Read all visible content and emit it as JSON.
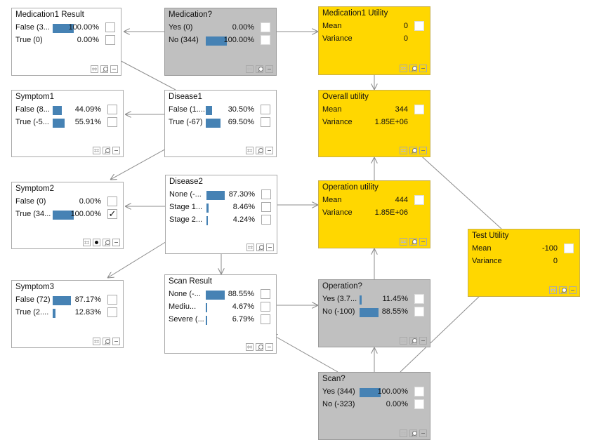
{
  "colors": {
    "bar": "#4682b4",
    "decision_bg": "#c0c0c0",
    "utility_bg": "#ffd700",
    "chance_bg": "#ffffff",
    "edge": "#8c8c8c"
  },
  "nodes": {
    "medication1_result": {
      "title": "Medication1 Result",
      "type": "chance",
      "states": [
        {
          "label": "False (3...",
          "prob": 1.0,
          "pct": "100.00%",
          "checked": false
        },
        {
          "label": "True (0)",
          "prob": 0.0,
          "pct": "0.00%",
          "checked": false
        }
      ]
    },
    "medication": {
      "title": "Medication?",
      "type": "decision",
      "states": [
        {
          "label": "Yes (0)",
          "prob": 0.0,
          "pct": "0.00%",
          "checked": false
        },
        {
          "label": "No (344)",
          "prob": 1.0,
          "pct": "100.00%",
          "checked": false
        }
      ]
    },
    "medication1_utility": {
      "title": "Medication1 Utility",
      "type": "utility",
      "mean_label": "Mean",
      "mean": "0",
      "variance_label": "Variance",
      "variance": "0"
    },
    "symptom1": {
      "title": "Symptom1",
      "type": "chance",
      "states": [
        {
          "label": "False (8...",
          "prob": 0.4409,
          "pct": "44.09%",
          "checked": false
        },
        {
          "label": "True (-5...",
          "prob": 0.5591,
          "pct": "55.91%",
          "checked": false
        }
      ]
    },
    "disease1": {
      "title": "Disease1",
      "type": "chance",
      "states": [
        {
          "label": "False (1....",
          "prob": 0.305,
          "pct": "30.50%",
          "checked": false
        },
        {
          "label": "True (-67)",
          "prob": 0.695,
          "pct": "69.50%",
          "checked": false
        }
      ]
    },
    "overall_utility": {
      "title": "Overall utility",
      "type": "utility",
      "mean_label": "Mean",
      "mean": "344",
      "variance_label": "Variance",
      "variance": "1.85E+06"
    },
    "symptom2": {
      "title": "Symptom2",
      "type": "chance",
      "evidence": true,
      "states": [
        {
          "label": "False (0)",
          "prob": 0.0,
          "pct": "0.00%",
          "checked": false
        },
        {
          "label": "True (34...",
          "prob": 1.0,
          "pct": "100.00%",
          "checked": true
        }
      ]
    },
    "disease2": {
      "title": "Disease2",
      "type": "chance",
      "states": [
        {
          "label": "None (-...",
          "prob": 0.873,
          "pct": "87.30%",
          "checked": false
        },
        {
          "label": "Stage 1...",
          "prob": 0.0846,
          "pct": "8.46%",
          "checked": false
        },
        {
          "label": "Stage 2...",
          "prob": 0.0424,
          "pct": "4.24%",
          "checked": false
        }
      ]
    },
    "operation_utility": {
      "title": "Operation utility",
      "type": "utility",
      "mean_label": "Mean",
      "mean": "444",
      "variance_label": "Variance",
      "variance": "1.85E+06"
    },
    "test_utility": {
      "title": "Test Utility",
      "type": "utility",
      "mean_label": "Mean",
      "mean": "-100",
      "variance_label": "Variance",
      "variance": "0"
    },
    "symptom3": {
      "title": "Symptom3",
      "type": "chance",
      "states": [
        {
          "label": "False (72)",
          "prob": 0.8717,
          "pct": "87.17%",
          "checked": false
        },
        {
          "label": "True (2....",
          "prob": 0.1283,
          "pct": "12.83%",
          "checked": false
        }
      ]
    },
    "scan_result": {
      "title": "Scan Result",
      "type": "chance",
      "states": [
        {
          "label": "None (-...",
          "prob": 0.8855,
          "pct": "88.55%",
          "checked": false
        },
        {
          "label": "Mediu...",
          "prob": 0.0467,
          "pct": "4.67%",
          "checked": false
        },
        {
          "label": "Severe (...",
          "prob": 0.0679,
          "pct": "6.79%",
          "checked": false
        }
      ]
    },
    "operation": {
      "title": "Operation?",
      "type": "decision",
      "states": [
        {
          "label": "Yes (3.7...",
          "prob": 0.1145,
          "pct": "11.45%",
          "checked": false
        },
        {
          "label": "No (-100)",
          "prob": 0.8855,
          "pct": "88.55%",
          "checked": false
        }
      ]
    },
    "scan": {
      "title": "Scan?",
      "type": "decision",
      "states": [
        {
          "label": "Yes (344)",
          "prob": 1.0,
          "pct": "100.00%",
          "checked": false
        },
        {
          "label": "No (-323)",
          "prob": 0.0,
          "pct": "0.00%",
          "checked": false
        }
      ]
    }
  },
  "edges": [
    {
      "from": "medication",
      "to": "medication1_result"
    },
    {
      "from": "medication",
      "to": "medication1_utility"
    },
    {
      "from": "disease1",
      "to": "medication1_result"
    },
    {
      "from": "disease1",
      "to": "symptom1"
    },
    {
      "from": "disease1",
      "to": "symptom2"
    },
    {
      "from": "medication1_utility",
      "to": "overall_utility"
    },
    {
      "from": "disease2",
      "to": "symptom2"
    },
    {
      "from": "disease2",
      "to": "operation_utility"
    },
    {
      "from": "disease2",
      "to": "symptom3"
    },
    {
      "from": "disease2",
      "to": "scan_result"
    },
    {
      "from": "operation_utility",
      "to": "overall_utility"
    },
    {
      "from": "test_utility",
      "to": "overall_utility"
    },
    {
      "from": "scan_result",
      "to": "operation"
    },
    {
      "from": "operation",
      "to": "operation_utility"
    },
    {
      "from": "scan",
      "to": "scan_result"
    },
    {
      "from": "scan",
      "to": "operation"
    },
    {
      "from": "scan",
      "to": "test_utility"
    }
  ],
  "icons": {
    "check": "✓"
  }
}
